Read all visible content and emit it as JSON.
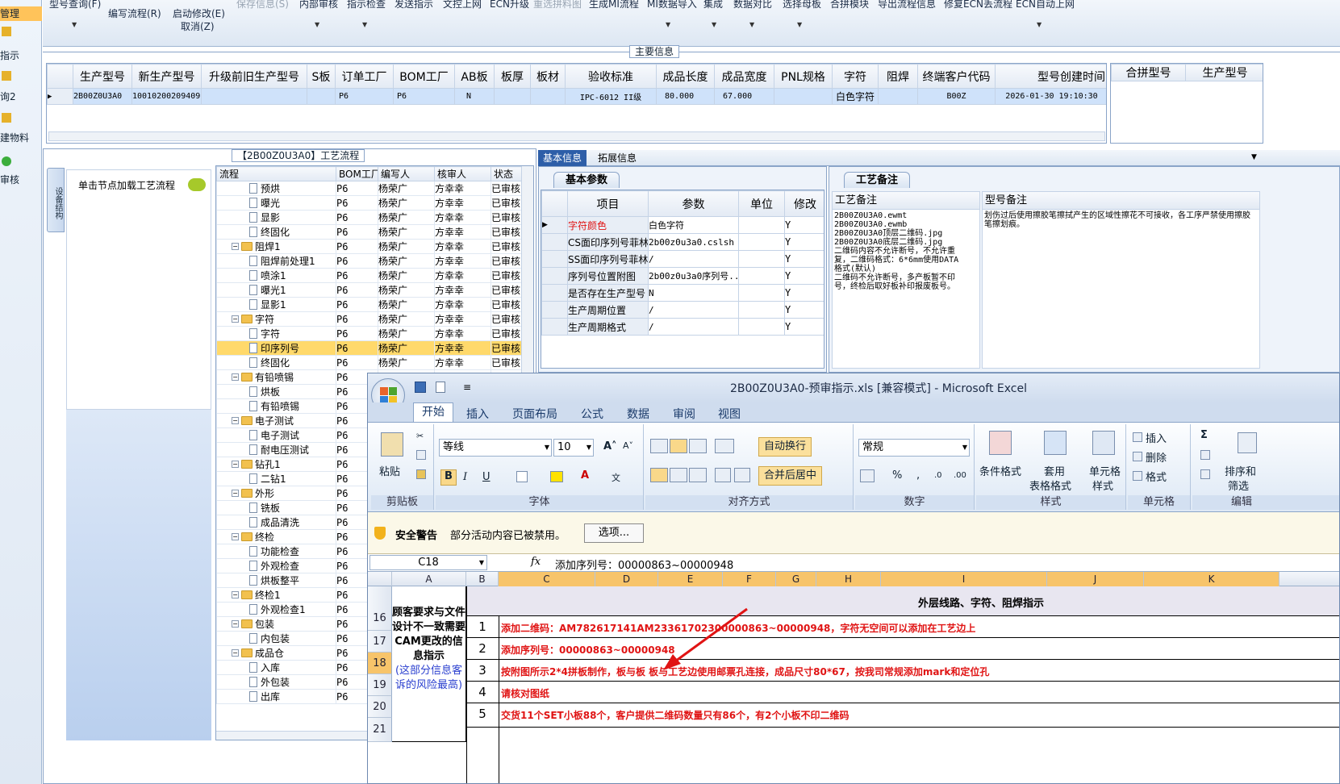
{
  "left_nav": {
    "items": [
      {
        "label": "管理",
        "selected": true
      },
      {
        "label": "指示"
      },
      {
        "label": "询2"
      },
      {
        "label": "建物料"
      },
      {
        "label": "审核"
      }
    ]
  },
  "toolbar": {
    "buttons": [
      {
        "label": "型号查询(F)",
        "enabled": true
      },
      {
        "label": "编写流程(R)",
        "enabled": true
      },
      {
        "label": "启动修改(E)",
        "enabled": true
      },
      {
        "label": "取消(Z)",
        "enabled": true
      },
      {
        "label": "保存信息(S)",
        "enabled": false
      },
      {
        "label": "内部审核",
        "enabled": true
      },
      {
        "label": "指示检查",
        "enabled": true
      },
      {
        "label": "发送指示",
        "enabled": true
      },
      {
        "label": "文控上网",
        "enabled": true
      },
      {
        "label": "ECN升级",
        "enabled": true
      },
      {
        "label": "重选拼料图",
        "enabled": false
      },
      {
        "label": "生成MI流程",
        "enabled": true
      },
      {
        "label": "MI数据导入",
        "enabled": true
      },
      {
        "label": "集成",
        "enabled": true
      },
      {
        "label": "数据对比",
        "enabled": true
      },
      {
        "label": "选择母板",
        "enabled": true
      },
      {
        "label": "合拼模块",
        "enabled": true
      },
      {
        "label": "导出流程信息",
        "enabled": true
      },
      {
        "label": "修复ECN丢流程",
        "enabled": true
      },
      {
        "label": "ECN自动上网",
        "enabled": true
      }
    ]
  },
  "main_info": {
    "title": "主要信息",
    "columns": [
      "生产型号",
      "新生产型号",
      "升级前旧生产型号",
      "S板",
      "订单工厂",
      "BOM工厂",
      "AB板",
      "板厚",
      "板材",
      "验收标准",
      "成品长度",
      "成品宽度",
      "PNL规格",
      "字符",
      "阻焊",
      "终端客户代码",
      "型号创建时间"
    ],
    "row": [
      "2B00Z0U3A0",
      "10010200209409",
      "",
      "",
      "P6",
      "P6",
      "N",
      "",
      "",
      "IPC-6012 II级",
      "80.000",
      "67.000",
      "",
      "白色字符",
      "",
      "B00Z",
      "2026-01-30 19:10:30"
    ],
    "side_columns": [
      "合拼型号",
      "生产型号"
    ]
  },
  "process_panel": {
    "title": "【2B00Z0U3A0】工艺流程",
    "vertical_tab": "设备结构",
    "hint": "单击节点加载工艺流程",
    "columns": [
      "流程",
      "BOM工厂",
      "编写人",
      "核审人",
      "状态"
    ],
    "rows": [
      {
        "name": "预烘",
        "level": 2,
        "factory": "P6",
        "writer": "杨荣广",
        "checker": "方幸幸",
        "status": "已审核"
      },
      {
        "name": "曝光",
        "level": 2,
        "factory": "P6",
        "writer": "杨荣广",
        "checker": "方幸幸",
        "status": "已审核"
      },
      {
        "name": "显影",
        "level": 2,
        "factory": "P6",
        "writer": "杨荣广",
        "checker": "方幸幸",
        "status": "已审核"
      },
      {
        "name": "终固化",
        "level": 2,
        "factory": "P6",
        "writer": "杨荣广",
        "checker": "方幸幸",
        "status": "已审核"
      },
      {
        "name": "阻焊1",
        "level": 1,
        "factory": "P6",
        "writer": "杨荣广",
        "checker": "方幸幸",
        "status": "已审核"
      },
      {
        "name": "阻焊前处理1",
        "level": 2,
        "factory": "P6",
        "writer": "杨荣广",
        "checker": "方幸幸",
        "status": "已审核"
      },
      {
        "name": "喷涂1",
        "level": 2,
        "factory": "P6",
        "writer": "杨荣广",
        "checker": "方幸幸",
        "status": "已审核"
      },
      {
        "name": "曝光1",
        "level": 2,
        "factory": "P6",
        "writer": "杨荣广",
        "checker": "方幸幸",
        "status": "已审核"
      },
      {
        "name": "显影1",
        "level": 2,
        "factory": "P6",
        "writer": "杨荣广",
        "checker": "方幸幸",
        "status": "已审核"
      },
      {
        "name": "字符",
        "level": 1,
        "factory": "P6",
        "writer": "杨荣广",
        "checker": "方幸幸",
        "status": "已审核"
      },
      {
        "name": "字符",
        "level": 2,
        "factory": "P6",
        "writer": "杨荣广",
        "checker": "方幸幸",
        "status": "已审核"
      },
      {
        "name": "印序列号",
        "level": 2,
        "factory": "P6",
        "writer": "杨荣广",
        "checker": "方幸幸",
        "status": "已审核",
        "highlight": true
      },
      {
        "name": "终固化",
        "level": 2,
        "factory": "P6",
        "writer": "杨荣广",
        "checker": "方幸幸",
        "status": "已审核"
      },
      {
        "name": "有铅喷锡",
        "level": 1,
        "factory": "P6",
        "writer": "",
        "checker": "",
        "status": ""
      },
      {
        "name": "烘板",
        "level": 2,
        "factory": "P6",
        "writer": "",
        "checker": "",
        "status": ""
      },
      {
        "name": "有铅喷锡",
        "level": 2,
        "factory": "P6",
        "writer": "",
        "checker": "",
        "status": ""
      },
      {
        "name": "电子测试",
        "level": 1,
        "factory": "P6",
        "writer": "",
        "checker": "",
        "status": ""
      },
      {
        "name": "电子测试",
        "level": 2,
        "factory": "P6",
        "writer": "",
        "checker": "",
        "status": ""
      },
      {
        "name": "耐电压测试",
        "level": 2,
        "factory": "P6",
        "writer": "",
        "checker": "",
        "status": ""
      },
      {
        "name": "钻孔1",
        "level": 1,
        "factory": "P6",
        "writer": "",
        "checker": "",
        "status": ""
      },
      {
        "name": "二钻1",
        "level": 2,
        "factory": "P6",
        "writer": "",
        "checker": "",
        "status": ""
      },
      {
        "name": "外形",
        "level": 1,
        "factory": "P6",
        "writer": "",
        "checker": "",
        "status": ""
      },
      {
        "name": "铣板",
        "level": 2,
        "factory": "P6",
        "writer": "",
        "checker": "",
        "status": ""
      },
      {
        "name": "成品清洗",
        "level": 2,
        "factory": "P6",
        "writer": "",
        "checker": "",
        "status": ""
      },
      {
        "name": "终检",
        "level": 1,
        "factory": "P6",
        "writer": "",
        "checker": "",
        "status": ""
      },
      {
        "name": "功能检查",
        "level": 2,
        "factory": "P6",
        "writer": "",
        "checker": "",
        "status": ""
      },
      {
        "name": "外观检查",
        "level": 2,
        "factory": "P6",
        "writer": "",
        "checker": "",
        "status": ""
      },
      {
        "name": "烘板整平",
        "level": 2,
        "factory": "P6",
        "writer": "",
        "checker": "",
        "status": ""
      },
      {
        "name": "终检1",
        "level": 1,
        "factory": "P6",
        "writer": "",
        "checker": "",
        "status": ""
      },
      {
        "name": "外观检查1",
        "level": 2,
        "factory": "P6",
        "writer": "",
        "checker": "",
        "status": ""
      },
      {
        "name": "包装",
        "level": 1,
        "factory": "P6",
        "writer": "",
        "checker": "",
        "status": ""
      },
      {
        "name": "内包装",
        "level": 2,
        "factory": "P6",
        "writer": "",
        "checker": "",
        "status": ""
      },
      {
        "name": "成品仓",
        "level": 1,
        "factory": "P6",
        "writer": "",
        "checker": "",
        "status": ""
      },
      {
        "name": "入库",
        "level": 2,
        "factory": "P6",
        "writer": "",
        "checker": "",
        "status": ""
      },
      {
        "name": "外包装",
        "level": 2,
        "factory": "P6",
        "writer": "",
        "checker": "",
        "status": ""
      },
      {
        "name": "出库",
        "level": 2,
        "factory": "P6",
        "writer": "",
        "checker": "",
        "status": ""
      }
    ]
  },
  "info_tabs": {
    "tabs": [
      "基本信息",
      "拓展信息"
    ],
    "active": 0
  },
  "basic_params": {
    "title": "基本参数",
    "columns": [
      "项目",
      "参数",
      "单位",
      "修改"
    ],
    "rows": [
      {
        "item": "字符颜色",
        "param": "白色字符",
        "unit": "",
        "mod": "Y",
        "item_red": true
      },
      {
        "item": "CS面印序列号菲林",
        "param": "2b00z0u3a0.cslsh",
        "unit": "",
        "mod": "Y"
      },
      {
        "item": "SS面印序列号菲林",
        "param": "/",
        "unit": "",
        "mod": "Y"
      },
      {
        "item": "序列号位置附图",
        "param": "2b00z0u3a0序列号...",
        "unit": "",
        "mod": "Y"
      },
      {
        "item": "是否存在生产型号",
        "param": "N",
        "unit": "",
        "mod": "Y"
      },
      {
        "item": "生产周期位置",
        "param": "/",
        "unit": "",
        "mod": "Y"
      },
      {
        "item": "生产周期格式",
        "param": "/",
        "unit": "",
        "mod": "Y"
      }
    ]
  },
  "process_notes": {
    "title": "工艺备注",
    "col1": "工艺备注",
    "col2": "型号备注",
    "note1": "2B00Z0U3A0.ewmt\n2B00Z0U3A0.ewmb\n2B00Z0U3A0顶层二维码.jpg\n2B00Z0U3A0底层二维码.jpg\n二维码内容不允许断号，不允许重复，二维码格式：6*6mm使用DATA格式(默认)\n二维码不允许断号，多产板暂不印号，终检后取好板补印报废板号。",
    "note2": "划伤过后使用擦胶笔擦拭产生的区域性擦花不可接收，各工序严禁使用擦胶笔擦划痕。"
  },
  "excel": {
    "title": "2B00Z0U3A0-预审指示.xls [兼容模式] - Microsoft Excel",
    "tabs": [
      "开始",
      "插入",
      "页面布局",
      "公式",
      "数据",
      "审阅",
      "视图"
    ],
    "ribbon": {
      "paste": "粘贴",
      "font_name": "等线",
      "font_size": "10",
      "wrap": "自动换行",
      "merge": "合并后居中",
      "number_format": "常规",
      "cond_format": "条件格式",
      "table_format_1": "套用",
      "table_format_2": "表格格式",
      "cell_style_1": "单元格",
      "cell_style_2": "样式",
      "insert": "插入",
      "delete": "删除",
      "format": "格式",
      "sort_1": "排序和",
      "sort_2": "筛选",
      "groups": [
        "剪贴板",
        "字体",
        "对齐方式",
        "数字",
        "样式",
        "单元格",
        "编辑"
      ]
    },
    "warning_title": "安全警告",
    "warning_text": "部分活动内容已被禁用。",
    "warning_btn": "选项...",
    "name_box": "C18",
    "formula": "添加序列号：00000863~00000948",
    "columns": [
      "A",
      "B",
      "C",
      "D",
      "E",
      "F",
      "G",
      "H",
      "I",
      "J",
      "K"
    ],
    "rows": [
      "16",
      "17",
      "18",
      "19",
      "20",
      "21"
    ],
    "header_text": "外层线路、字符、阻焊指示",
    "merged_a": "顾客要求与文件设计不一致需要CAM更改的信息指示",
    "merged_a_blue": "(这部分信息客诉的风险最高)",
    "lines": [
      {
        "n": "1",
        "text": "添加二维码：AM782617141AM23361702300000863~00000948，字符无空间可以添加在工艺边上"
      },
      {
        "n": "2",
        "text": "添加序列号：00000863~00000948"
      },
      {
        "n": "3",
        "text": "按附图所示2*4拼板制作，板与板 板与工艺边使用邮票孔连接，成品尺寸80*67，按我司常规添加mark和定位孔"
      },
      {
        "n": "4",
        "text": "请核对图纸"
      },
      {
        "n": "5",
        "text": "交货11个SET小板88个，客户提供二维码数量只有86个，有2个小板不印二维码"
      }
    ]
  }
}
